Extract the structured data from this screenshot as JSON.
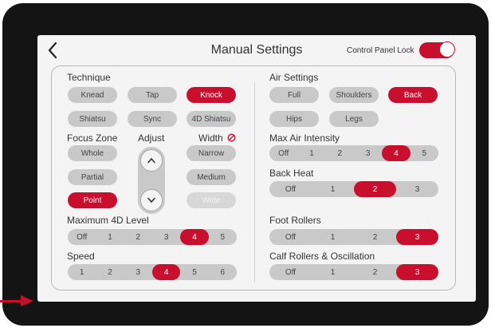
{
  "header": {
    "title": "Manual Settings",
    "lock_label": "Control Panel Lock",
    "lock_on": true
  },
  "technique": {
    "label": "Technique",
    "options": [
      "Knead",
      "Tap",
      "Knock",
      "Shiatsu",
      "Sync",
      "4D Shiatsu"
    ],
    "selected": "Knock"
  },
  "focus_zone": {
    "label": "Focus Zone",
    "options": [
      "Whole",
      "Partial",
      "Point"
    ],
    "selected": "Point"
  },
  "adjust": {
    "label": "Adjust"
  },
  "width": {
    "label": "Width",
    "options": [
      "Narrow",
      "Medium",
      "Wide"
    ],
    "disabled": [
      "Wide"
    ]
  },
  "max_4d_level": {
    "label": "Maximum 4D Level",
    "options": [
      "Off",
      "1",
      "2",
      "3",
      "4",
      "5"
    ],
    "selected": "4"
  },
  "speed": {
    "label": "Speed",
    "options": [
      "1",
      "2",
      "3",
      "4",
      "5",
      "6"
    ],
    "selected": "4"
  },
  "air_settings": {
    "label": "Air Settings",
    "options": [
      "Full",
      "Shoulders",
      "Back",
      "Hips",
      "Legs"
    ],
    "selected": "Back"
  },
  "max_air_intensity": {
    "label": "Max Air Intensity",
    "options": [
      "Off",
      "1",
      "2",
      "3",
      "4",
      "5"
    ],
    "selected": "4"
  },
  "back_heat": {
    "label": "Back Heat",
    "options": [
      "Off",
      "1",
      "2",
      "3"
    ],
    "selected": "2"
  },
  "foot_rollers": {
    "label": "Foot Rollers",
    "options": [
      "Off",
      "1",
      "2",
      "3"
    ],
    "selected": "3"
  },
  "calf_rollers": {
    "label": "Calf Rollers & Oscillation",
    "options": [
      "Off",
      "1",
      "2",
      "3"
    ],
    "selected": "3"
  },
  "colors": {
    "accent": "#c8102e",
    "pill": "#c9c9c9",
    "device": "#141414"
  }
}
